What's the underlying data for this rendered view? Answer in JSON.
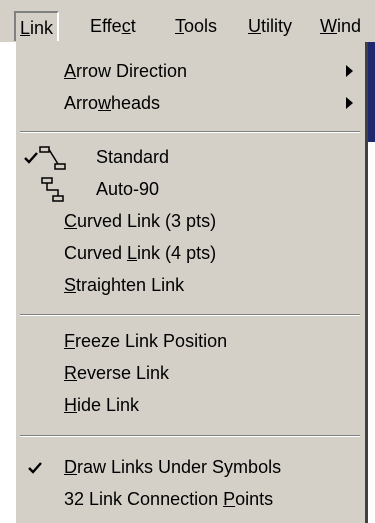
{
  "menubar": {
    "items": [
      {
        "label": "Link",
        "accel": "L",
        "active": true
      },
      {
        "label": "Effect",
        "accel": "c"
      },
      {
        "label": "Tools",
        "accel": "T"
      },
      {
        "label": "Utility",
        "accel": "U"
      },
      {
        "label": "Wind",
        "accel": "W"
      }
    ]
  },
  "menu": {
    "arrow_direction": {
      "pre": "",
      "accel": "A",
      "post": "rrow Direction"
    },
    "arrowheads": {
      "pre": "Arro",
      "accel": "w",
      "post": "heads"
    },
    "standard": {
      "label": "Standard",
      "checked": true,
      "icon": "standard-link-icon"
    },
    "auto90": {
      "label": "Auto-90",
      "icon": "auto90-link-icon"
    },
    "curved3": {
      "pre": "",
      "accel": "C",
      "post": "urved Link (3 pts)"
    },
    "curved4": {
      "pre": "Curved ",
      "accel": "L",
      "post": "ink (4 pts)"
    },
    "straighten": {
      "pre": "",
      "accel": "S",
      "post": "traighten Link"
    },
    "freeze": {
      "pre": "",
      "accel": "F",
      "post": "reeze Link Position"
    },
    "reverse": {
      "pre": "",
      "accel": "R",
      "post": "everse Link"
    },
    "hide": {
      "pre": "",
      "accel": "H",
      "post": "ide Link"
    },
    "draw_under": {
      "pre": "",
      "accel": "D",
      "post": "raw Links Under Symbols",
      "checked": true
    },
    "connection_points": {
      "pre": "32 Link Connection ",
      "accel": "P",
      "post": "oints"
    }
  },
  "colors": {
    "menu_bg": "#d4d0c8",
    "shadow": "#808080",
    "highlight": "#ffffff",
    "dark_window": "#1f2a6e"
  }
}
